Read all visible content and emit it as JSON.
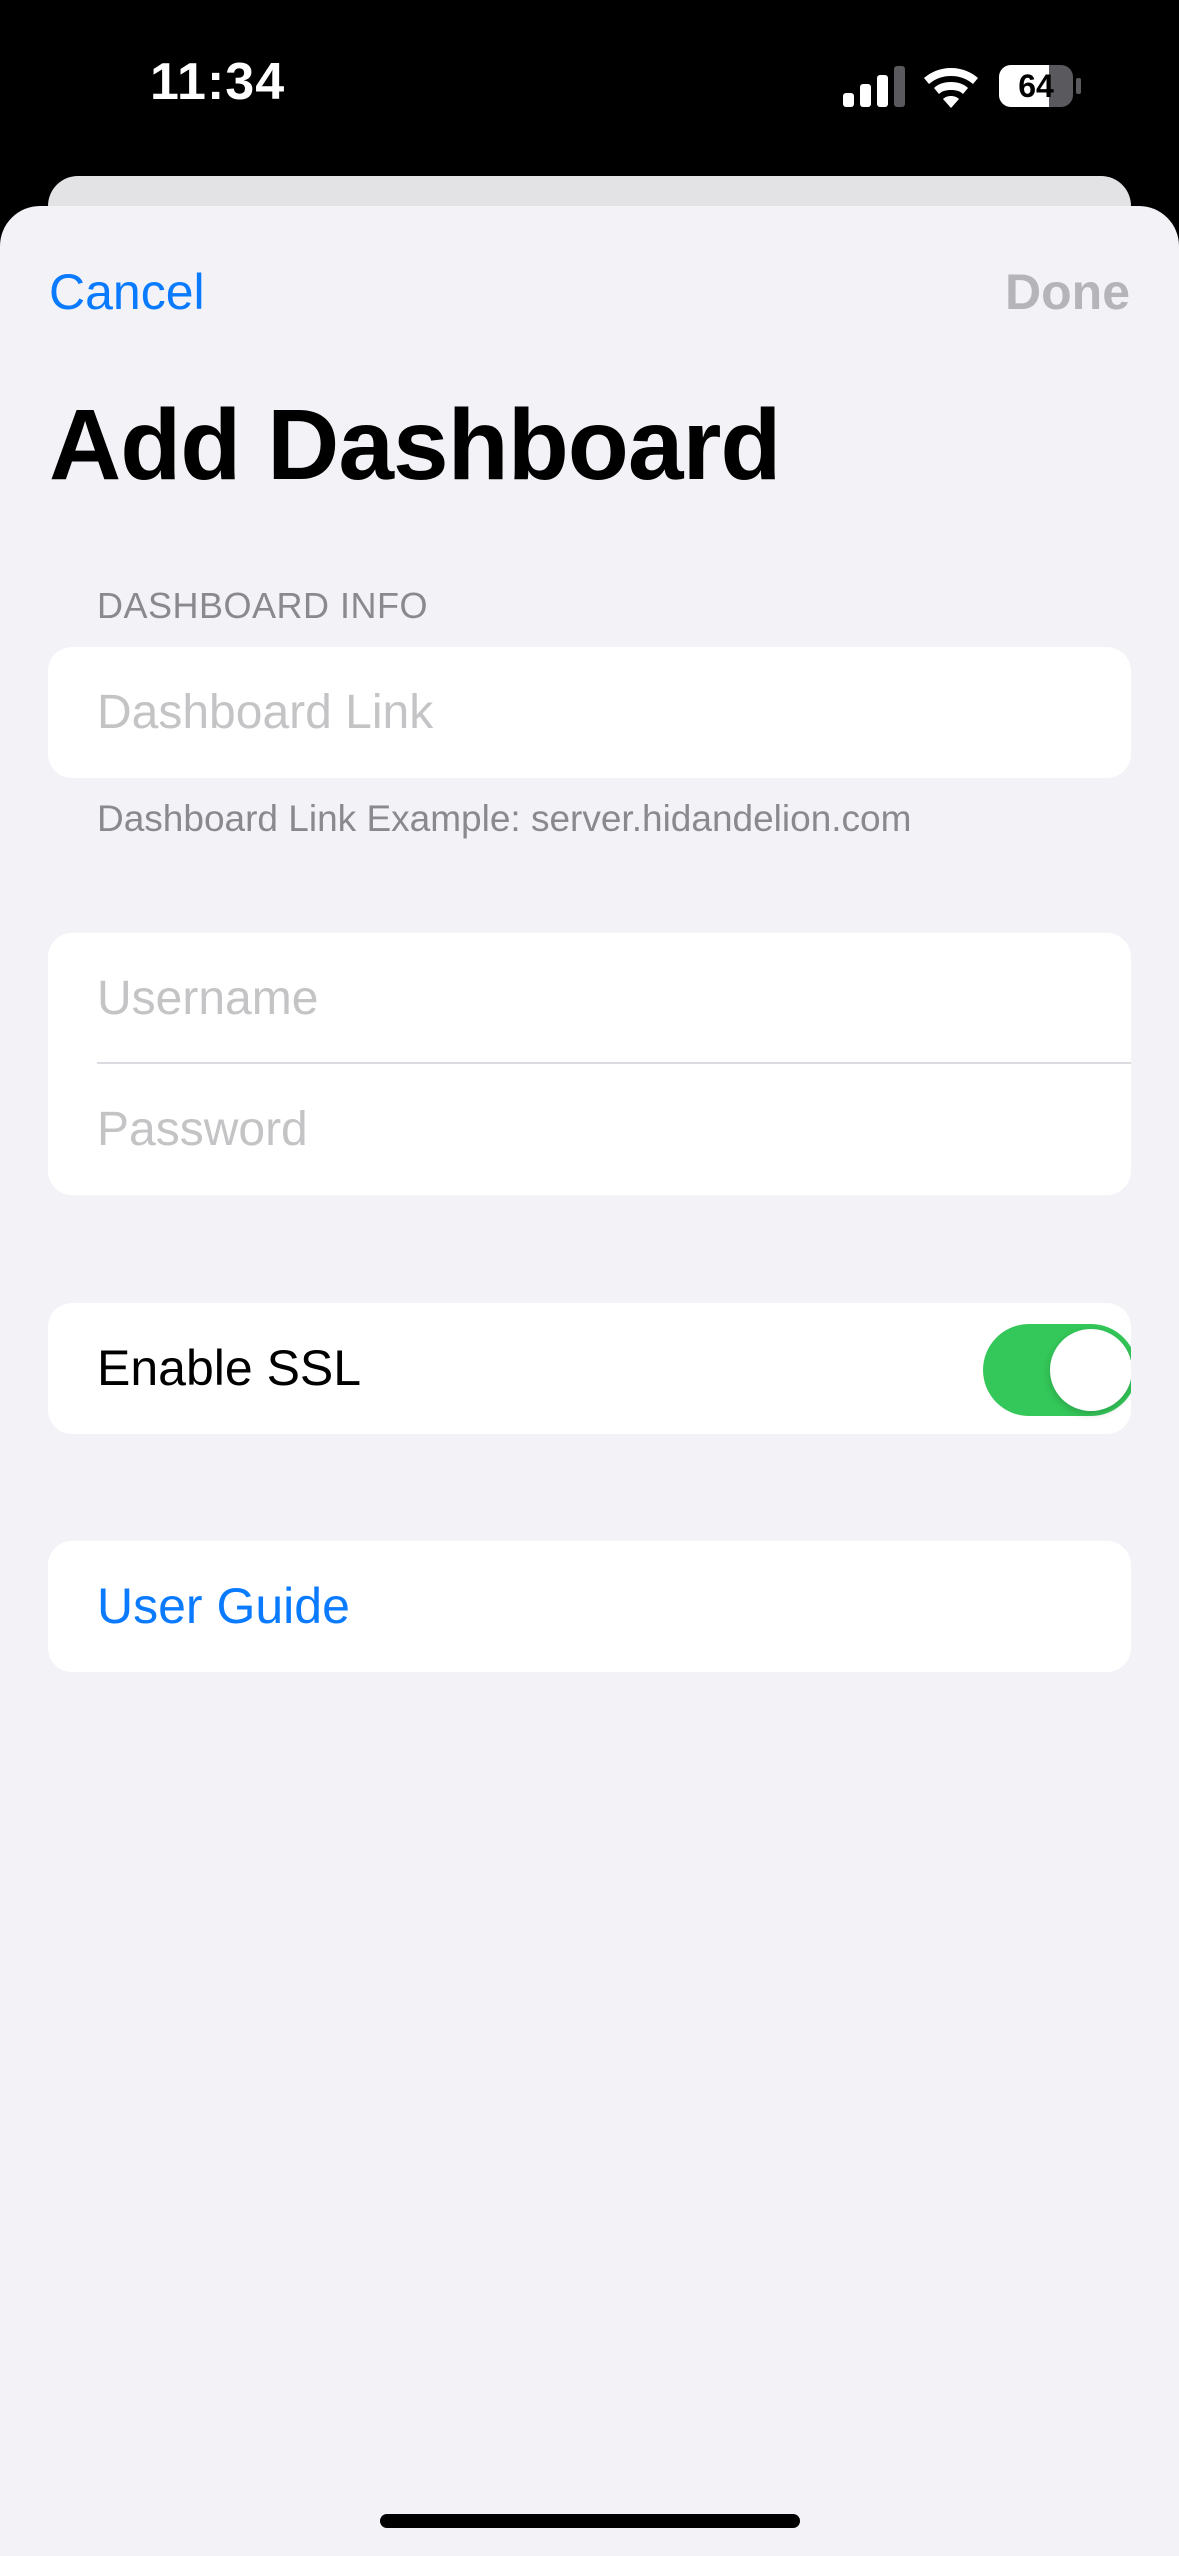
{
  "status_bar": {
    "time": "11:34",
    "battery_level": "64",
    "icons": [
      "cellular-signal-icon",
      "wifi-icon",
      "battery-icon"
    ]
  },
  "nav": {
    "cancel_label": "Cancel",
    "done_label": "Done"
  },
  "title": "Add Dashboard",
  "dashboard_info": {
    "header": "DASHBOARD INFO",
    "link_placeholder": "Dashboard Link",
    "link_value": "",
    "footer": "Dashboard Link Example: server.hidandelion.com"
  },
  "credentials": {
    "username_placeholder": "Username",
    "username_value": "",
    "password_placeholder": "Password",
    "password_value": ""
  },
  "ssl": {
    "label": "Enable SSL",
    "enabled": true
  },
  "user_guide": {
    "label": "User Guide"
  },
  "colors": {
    "accent": "#0a7aff",
    "toggle_on": "#34c759",
    "sheet_background": "#f2f2f7",
    "placeholder": "#c4c4c6",
    "secondary_text": "#8a8a8e",
    "disabled_text": "#b5b5b9"
  }
}
